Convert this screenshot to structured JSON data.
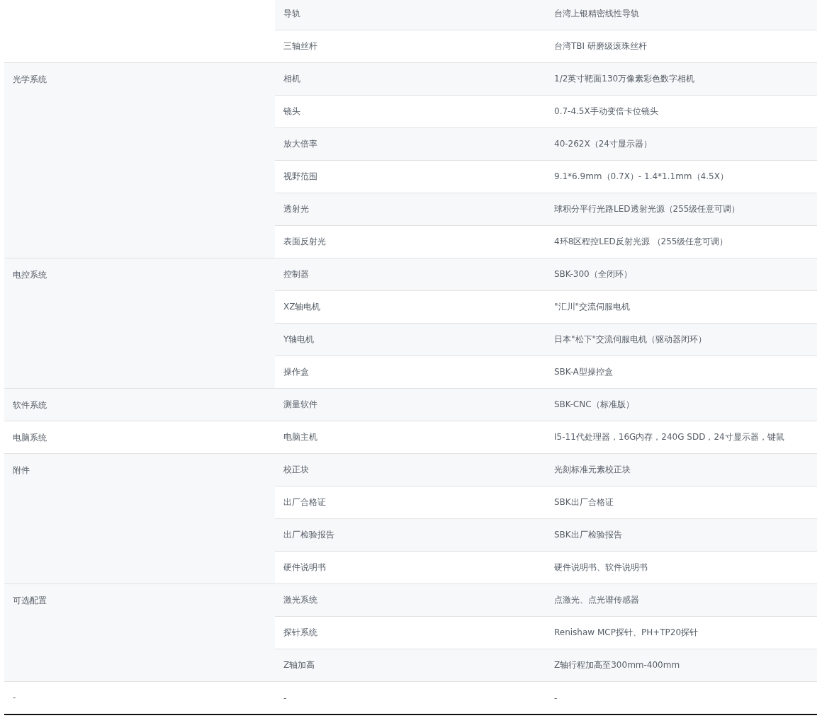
{
  "spec_table": {
    "groups": [
      {
        "items": [
          {
            "name": "导轨",
            "value": "台湾上银精密线性导轨"
          },
          {
            "name": "三轴丝杆",
            "value": "台湾TBI 研磨级滚珠丝杆"
          }
        ]
      },
      {
        "label": "光学系统",
        "items": [
          {
            "name": "相机",
            "value": "1/2英寸靶面130万像素彩色数字相机"
          },
          {
            "name": "镜头",
            "value": "0.7-4.5X手动变倍卡位镜头"
          },
          {
            "name": "放大倍率",
            "value": "40-262X（24寸显示器）"
          },
          {
            "name": "视野范围",
            "value": "9.1*6.9mm（0.7X）- 1.4*1.1mm（4.5X）"
          },
          {
            "name": "透射光",
            "value": "球积分平行光路LED透射光源（255级任意可调）"
          },
          {
            "name": "表面反射光",
            "value": "4环8区程控LED反射光源 （255级任意可调）"
          }
        ]
      },
      {
        "label": "电控系统",
        "items": [
          {
            "name": "控制器",
            "value": "SBK-300（全闭环）"
          },
          {
            "name": "XZ轴电机",
            "value": "\"汇川\"交流伺服电机"
          },
          {
            "name": "Y轴电机",
            "value": "日本\"松下\"交流伺服电机（驱动器闭环）"
          },
          {
            "name": "操作盒",
            "value": "SBK-A型操控盒"
          }
        ]
      },
      {
        "label": "软件系统",
        "items": [
          {
            "name": "测量软件",
            "value": "SBK-CNC（标准版）"
          }
        ]
      },
      {
        "label": "电脑系统",
        "items": [
          {
            "name": "电脑主机",
            "value": "I5-11代处理器，16G内存，240G SDD，24寸显示器，键鼠"
          }
        ]
      },
      {
        "label": "附件",
        "items": [
          {
            "name": "校正块",
            "value": "光刻标准元素校正块"
          },
          {
            "name": "出厂合格证",
            "value": "SBK出厂合格证"
          },
          {
            "name": "出厂检验报告",
            "value": "SBK出厂检验报告"
          },
          {
            "name": "硬件说明书",
            "value": "硬件说明书、软件说明书"
          }
        ]
      },
      {
        "label": "可选配置",
        "items": [
          {
            "name": "激光系统",
            "value": "点激光、点光谱传感器"
          },
          {
            "name": "探针系统",
            "value": "Renishaw MCP探针、PH+TP20探针"
          },
          {
            "name": "Z轴加高",
            "value": "Z轴行程加高至300mm-400mm"
          }
        ]
      },
      {
        "label": "-",
        "items": [
          {
            "name": "-",
            "value": "-"
          }
        ]
      }
    ]
  }
}
